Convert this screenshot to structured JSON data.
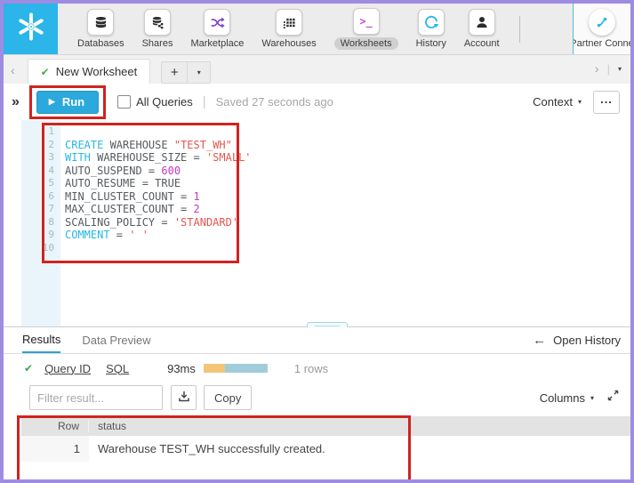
{
  "window": {
    "border_color": "#9e8ce2",
    "brand_color": "#2bb5e8"
  },
  "annotations": {
    "color": "#d0231f"
  },
  "icons": {
    "caret_down": "▾",
    "chevron_left": "‹",
    "chevron_right": "›",
    "double_chevron_right": "»",
    "check": "✔",
    "play": "▶",
    "left_arrow": "←",
    "pipe": "|",
    "plus": "+",
    "more": "...",
    "worksheets_glyph": ">_"
  },
  "nav": {
    "items": [
      {
        "label": "Databases"
      },
      {
        "label": "Shares"
      },
      {
        "label": "Marketplace"
      },
      {
        "label": "Warehouses"
      },
      {
        "label": "Worksheets",
        "active": true
      },
      {
        "label": "History"
      },
      {
        "label": "Account"
      }
    ],
    "partner_label": "Partner Conne"
  },
  "tabbar": {
    "tab_title": "New Worksheet"
  },
  "toolbar": {
    "run_label": "Run",
    "all_queries_label": "All Queries",
    "saved_status": "Saved 27 seconds ago",
    "context_label": "Context"
  },
  "editor": {
    "colors": {
      "kw": "#29b7e5",
      "id": "#555b5f",
      "str": "#e2574e",
      "num": "#c538c5"
    },
    "lines": [
      {
        "n": "1",
        "tokens": []
      },
      {
        "n": "2",
        "tokens": [
          {
            "t": "CREATE",
            "c": "kw"
          },
          {
            "t": " WAREHOUSE ",
            "c": "id"
          },
          {
            "t": "\"TEST_WH\"",
            "c": "str"
          }
        ]
      },
      {
        "n": "3",
        "tokens": [
          {
            "t": "WITH",
            "c": "kw"
          },
          {
            "t": " WAREHOUSE_SIZE = ",
            "c": "id"
          },
          {
            "t": "'SMALL'",
            "c": "str"
          }
        ]
      },
      {
        "n": "4",
        "tokens": [
          {
            "t": "AUTO_SUSPEND = ",
            "c": "id"
          },
          {
            "t": "600",
            "c": "num"
          }
        ]
      },
      {
        "n": "5",
        "tokens": [
          {
            "t": "AUTO_RESUME = TRUE",
            "c": "id"
          }
        ]
      },
      {
        "n": "6",
        "tokens": [
          {
            "t": "MIN_CLUSTER_COUNT = ",
            "c": "id"
          },
          {
            "t": "1",
            "c": "num"
          }
        ]
      },
      {
        "n": "7",
        "tokens": [
          {
            "t": "MAX_CLUSTER_COUNT = ",
            "c": "id"
          },
          {
            "t": "2",
            "c": "num"
          }
        ]
      },
      {
        "n": "8",
        "tokens": [
          {
            "t": "SCALING_POLICY = ",
            "c": "id"
          },
          {
            "t": "'STANDARD'",
            "c": "str"
          }
        ]
      },
      {
        "n": "9",
        "tokens": [
          {
            "t": "COMMENT",
            "c": "kw"
          },
          {
            "t": " = ",
            "c": "id"
          },
          {
            "t": "' '",
            "c": "str"
          }
        ]
      },
      {
        "n": "10",
        "tokens": []
      }
    ]
  },
  "results": {
    "tabs": [
      {
        "label": "Results",
        "active": true
      },
      {
        "label": "Data Preview",
        "active": false
      }
    ],
    "open_history_label": "Open History",
    "query": {
      "query_id_label": "Query ID",
      "sql_label": "SQL",
      "duration": "93ms",
      "rows_label": "1 rows",
      "progress": [
        {
          "color": "#f2c577",
          "pct": 33
        },
        {
          "color": "#a0cdd9",
          "pct": 67
        }
      ]
    },
    "filter_placeholder": "Filter result...",
    "copy_label": "Copy",
    "columns_label": "Columns",
    "table": {
      "columns": [
        "Row",
        "status"
      ],
      "rows": [
        [
          "1",
          "Warehouse TEST_WH successfully created."
        ]
      ]
    }
  }
}
